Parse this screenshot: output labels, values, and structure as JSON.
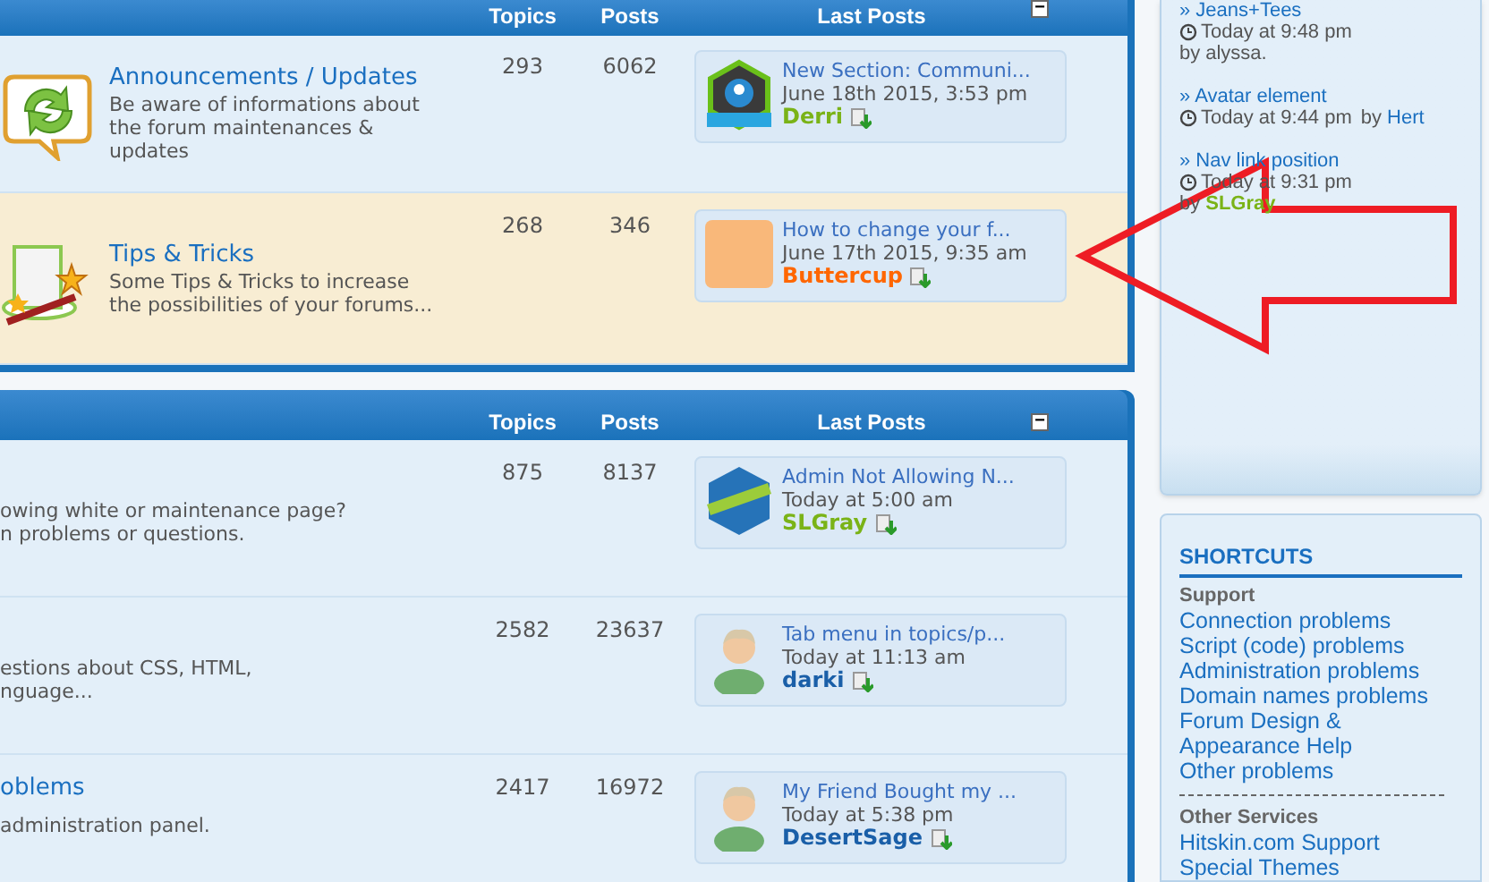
{
  "categories": [
    {
      "header": {
        "topics": "Topics",
        "posts": "Posts",
        "last_posts": "Last Posts",
        "collapse": "−"
      },
      "top_cut": true,
      "rows": [
        {
          "kind": "refresh",
          "title": "Announcements / Updates",
          "description": [
            "Be aware of informations about",
            "the forum maintenances &",
            "updates"
          ],
          "highlighted": false,
          "topics": "293",
          "posts": "6062",
          "last_post": {
            "kind": "hex-logo",
            "title": "New Section: Communi...",
            "time": "June 18th 2015, 3:53 pm",
            "author": "Derri",
            "color": "#7ab317"
          }
        },
        {
          "kind": "hat",
          "title": "Tips & Tricks",
          "description": [
            "Some Tips & Tricks to increase",
            "the possibilities of your forums..."
          ],
          "highlighted": true,
          "topics": "268",
          "posts": "346",
          "last_post": {
            "kind": "cartoon",
            "title": "How to change your f...",
            "time": "June 17th 2015, 9:35 am",
            "author": "Buttercup",
            "color": "#ff6600"
          }
        }
      ]
    },
    {
      "header": {
        "topics": "Topics",
        "posts": "Posts",
        "last_posts": "Last Posts",
        "collapse": "−"
      },
      "top_cut": false,
      "rows": [
        {
          "kind": "none",
          "title": "",
          "description": [
            "owing white or maintenance page?",
            "n problems or questions."
          ],
          "highlighted": false,
          "topics": "875",
          "posts": "8137",
          "last_post": {
            "kind": "hex-badge",
            "title": "Admin Not Allowing N...",
            "time": "Today at 5:00 am",
            "author": "SLGray",
            "color": "#7ab317"
          }
        },
        {
          "kind": "none",
          "title": "",
          "description": [
            "estions about CSS, HTML,",
            "nguage..."
          ],
          "highlighted": false,
          "topics": "2582",
          "posts": "23637",
          "last_post": {
            "kind": "silhouette",
            "title": "Tab menu in topics/p...",
            "time": "Today at 11:13 am",
            "author": "darki",
            "color": "#1a5fa8"
          }
        },
        {
          "kind": "none",
          "title": "oblems",
          "description": [
            "administration panel."
          ],
          "highlighted": false,
          "topics": "2417",
          "posts": "16972",
          "last_post": {
            "kind": "silhouette",
            "title": "My Friend Bought my ...",
            "time": "Today at 5:38 pm",
            "author": "DesertSage",
            "color": "#1a5fa8"
          }
        }
      ]
    }
  ],
  "recent_topics": [
    {
      "title": "» Jeans+Tees",
      "time": "Today at 9:48 pm",
      "by": "by",
      "author": "alyssa.",
      "color": "#555555",
      "same_line": false
    },
    {
      "title": "» Avatar element",
      "time": "Today at 9:44 pm",
      "by": "by",
      "author": "Hert",
      "color": "#1a6fc0",
      "same_line": true
    },
    {
      "title": "» Nav link position",
      "time": "Today at 9:31 pm",
      "by": "by",
      "author": "SLGray",
      "color": "#7ab317",
      "same_line": false
    }
  ],
  "shortcuts": {
    "title": "SHORTCUTS",
    "groups": [
      {
        "heading": "Support",
        "links": [
          "Connection problems",
          "Script (code) problems",
          "Administration problems",
          "Domain names problems",
          "Forum Design & Appearance Help",
          "Other problems"
        ]
      },
      {
        "heading": "Other Services",
        "links": [
          "Hitskin.com Support",
          "Special Themes"
        ]
      }
    ]
  },
  "annotation": {
    "kind": "arrow",
    "color": "#ee1c24"
  }
}
